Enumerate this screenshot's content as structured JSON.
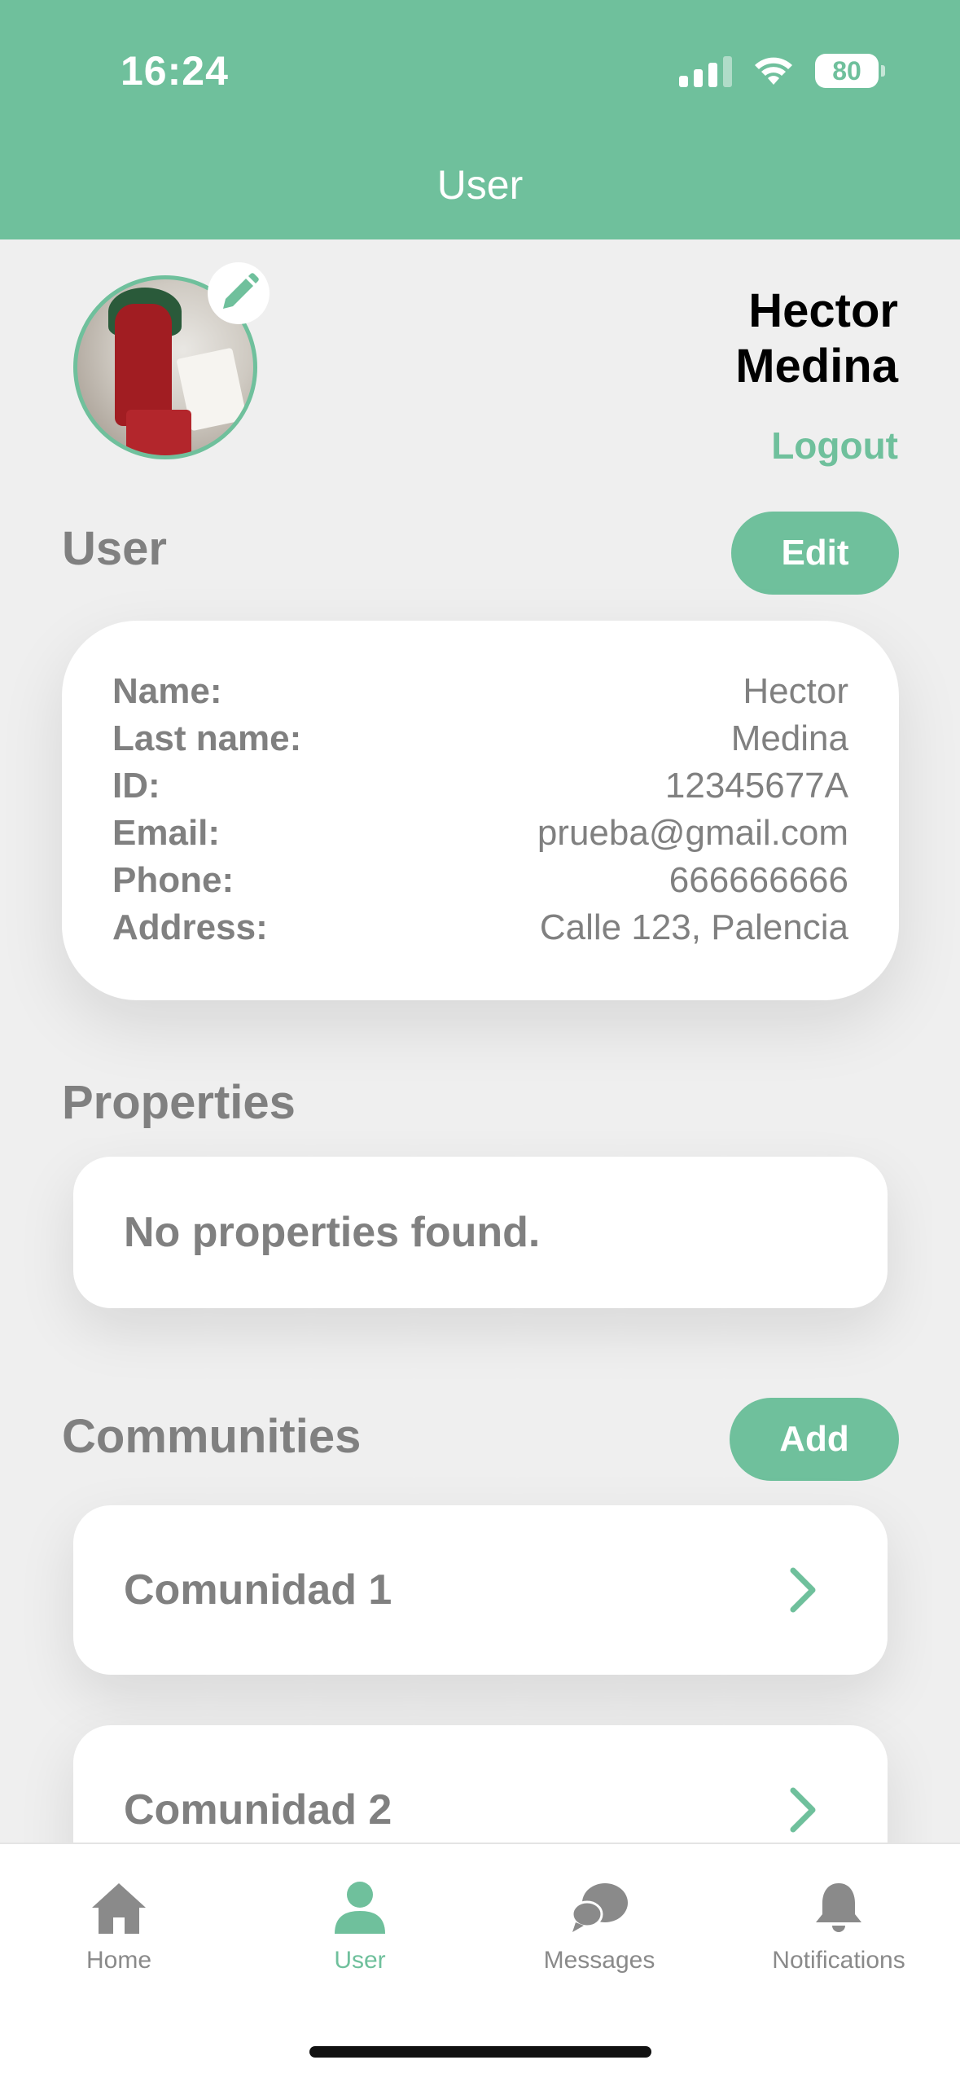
{
  "status_bar": {
    "time": "16:24",
    "battery": "80"
  },
  "header": {
    "title": "User"
  },
  "profile": {
    "first_name": "Hector",
    "last_name": "Medina",
    "logout_label": "Logout"
  },
  "user_section": {
    "title": "User",
    "edit_label": "Edit",
    "fields": [
      {
        "label": "Name:",
        "value": "Hector"
      },
      {
        "label": "Last name:",
        "value": "Medina"
      },
      {
        "label": "ID:",
        "value": "12345677A"
      },
      {
        "label": "Email:",
        "value": "prueba@gmail.com"
      },
      {
        "label": "Phone:",
        "value": "666666666"
      },
      {
        "label": "Address:",
        "value": "Calle 123, Palencia"
      }
    ]
  },
  "properties_section": {
    "title": "Properties",
    "empty_text": "No properties found."
  },
  "communities_section": {
    "title": "Communities",
    "add_label": "Add",
    "items": [
      {
        "name": "Comunidad 1"
      },
      {
        "name": "Comunidad 2"
      }
    ]
  },
  "tabbar": {
    "items": [
      {
        "label": "Home",
        "icon": "home-icon"
      },
      {
        "label": "User",
        "icon": "user-icon"
      },
      {
        "label": "Messages",
        "icon": "chat-bubbles-icon"
      },
      {
        "label": "Notifications",
        "icon": "bell-icon"
      }
    ],
    "active": "User"
  },
  "colors": {
    "accent": "#6fc09c",
    "text_muted": "#808080",
    "background": "#efefef"
  }
}
